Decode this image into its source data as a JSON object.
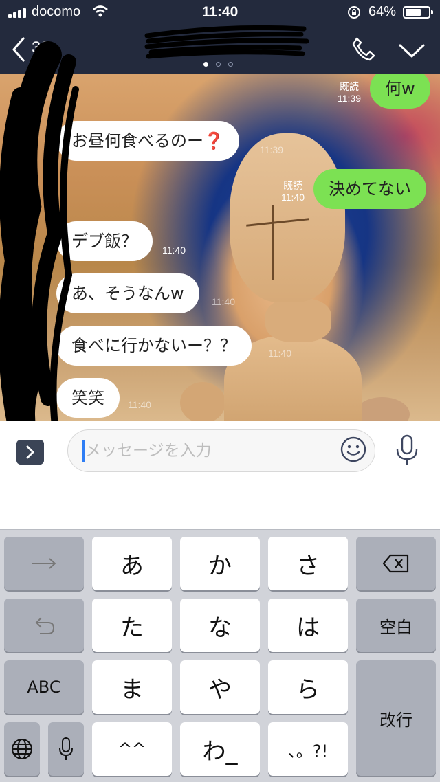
{
  "status_bar": {
    "carrier": "docomo",
    "time": "11:40",
    "battery": "64%"
  },
  "header": {
    "unread_count": "38",
    "page_indicator": {
      "count": 3,
      "active": 0
    }
  },
  "messages": [
    {
      "side": "out",
      "text": "何w",
      "read_label": "既読",
      "time": "11:39"
    },
    {
      "side": "in",
      "text": "お昼何食べるのー",
      "emoji": "❓",
      "time": "11:39"
    },
    {
      "side": "out",
      "text": "決めてない",
      "read_label": "既読",
      "time": "11:40"
    },
    {
      "side": "in",
      "text": "デブ飯？",
      "time": "11:40"
    },
    {
      "side": "in",
      "text": "あ、そうなんw",
      "time": "11:40"
    },
    {
      "side": "in",
      "text": "食べに行かないー？？",
      "time": "11:40"
    },
    {
      "side": "in",
      "text": "笑笑",
      "time": "11:40"
    }
  ],
  "input": {
    "placeholder": "メッセージを入力"
  },
  "keyboard": {
    "row1": [
      "あ",
      "か",
      "さ"
    ],
    "row2": [
      "た",
      "な",
      "は"
    ],
    "row3": [
      "ま",
      "や",
      "ら"
    ],
    "row4": [
      "^^",
      "わ_",
      "、。?!"
    ],
    "space_label": "空白",
    "abc_label": "ABC",
    "return_label": "改行"
  }
}
